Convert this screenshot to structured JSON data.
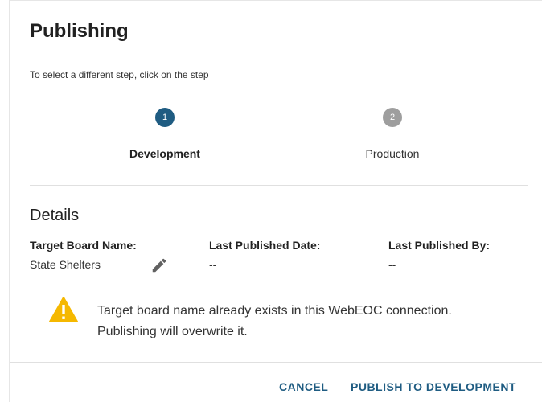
{
  "dialog": {
    "title": "Publishing",
    "hint": "To select a different step, click on the step"
  },
  "stepper": {
    "steps": [
      {
        "number": "1",
        "label": "Development",
        "active": true
      },
      {
        "number": "2",
        "label": "Production",
        "active": false
      }
    ]
  },
  "details": {
    "title": "Details",
    "columns": [
      {
        "header": "Target Board Name:",
        "value": "State Shelters"
      },
      {
        "header": "Last Published Date:",
        "value": "--"
      },
      {
        "header": "Last Published By:",
        "value": "--"
      }
    ]
  },
  "warning": {
    "icon": "warning-triangle-icon",
    "line1": "Target board name already exists in this WebEOC connection.",
    "line2": "Publishing will overwrite it."
  },
  "actions": {
    "cancel_label": "CANCEL",
    "publish_label": "PUBLISH TO DEVELOPMENT"
  },
  "colors": {
    "accent": "#1f5c82",
    "inactive_step": "#9e9e9e",
    "warning": "#f5b800"
  }
}
